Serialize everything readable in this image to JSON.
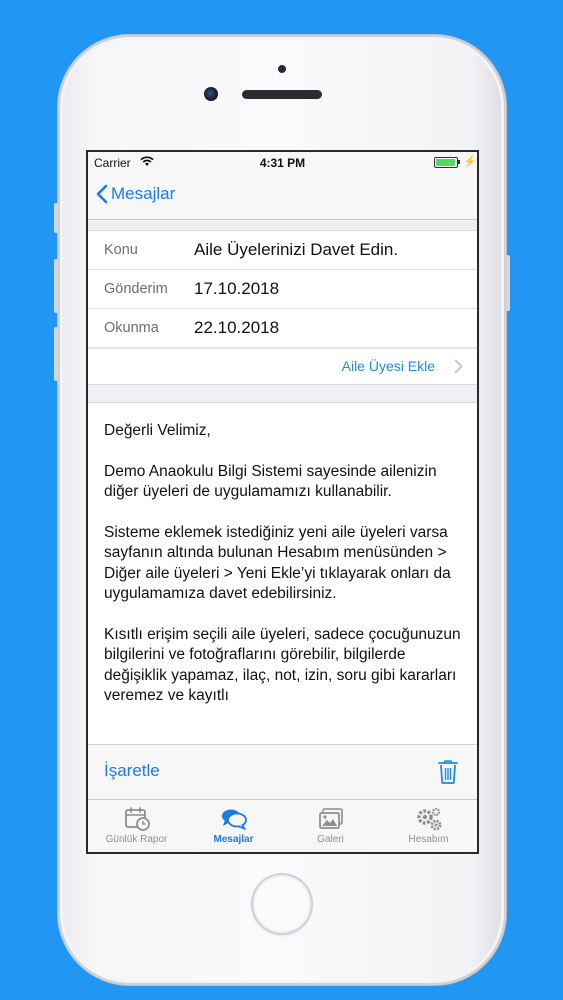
{
  "status_bar": {
    "carrier": "Carrier",
    "time": "4:31 PM"
  },
  "nav": {
    "back_label": "Mesajlar"
  },
  "details": [
    {
      "label": "Konu",
      "value": "Aile Üyelerinizi Davet Edin."
    },
    {
      "label": "Gönderim",
      "value": "17.10.2018"
    },
    {
      "label": "Okunma",
      "value": "22.10.2018"
    }
  ],
  "add_family_member": "Aile Üyesi Ekle",
  "message": {
    "paragraphs": [
      "Değerli Velimiz,",
      "Demo Anaokulu Bilgi Sistemi sayesinde ailenizin diğer üyeleri de uygulamamızı kullanabilir.",
      "Sisteme eklemek istediğiniz yeni aile üyeleri varsa sayfanın altında bulunan Hesabım menüsünden > Diğer aile üyeleri > Yeni Ekle’yi tıklayarak onları da uygulamamıza davet edebilirsiniz.",
      "Kısıtlı erişim seçili aile üyeleri, sadece çocuğunuzun bilgilerini ve fotoğraflarını görebilir,  bilgilerde değişiklik yapamaz, ilaç, not, izin, soru gibi kararları veremez ve kayıtlı"
    ]
  },
  "actions": {
    "mark_label": "İşaretle",
    "delete_icon": "trash-icon"
  },
  "tabs": [
    {
      "label": "Günlük Rapor",
      "icon": "calendar-clock-icon",
      "active": false
    },
    {
      "label": "Mesajlar",
      "icon": "chat-bubbles-icon",
      "active": true
    },
    {
      "label": "Galeri",
      "icon": "gallery-icon",
      "active": false
    },
    {
      "label": "Hesabım",
      "icon": "gears-icon",
      "active": false
    }
  ],
  "colors": {
    "accent": "#1b7ce6",
    "background": "#2196f3",
    "battery": "#4cd964",
    "inactive": "#8e8e93"
  }
}
